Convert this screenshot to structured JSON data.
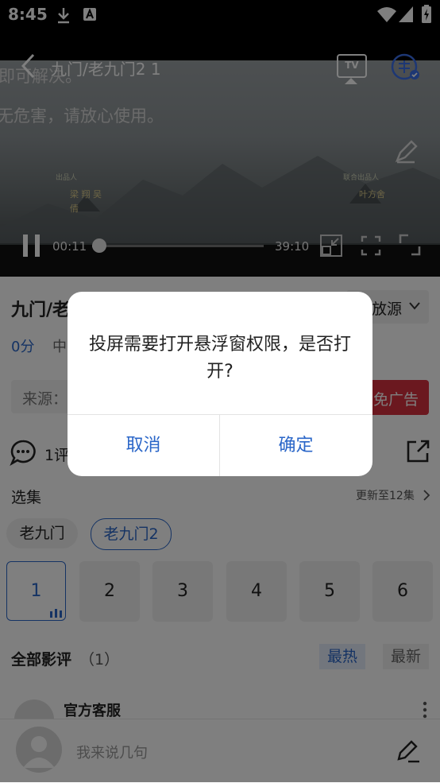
{
  "status_bar": {
    "time": "8:45"
  },
  "player": {
    "title": "九门/老九门2 1",
    "subtitle_top": "即可解决。",
    "subtitle_line": "无危害，请放心使用。",
    "credit_left_role": "出品人",
    "credit_left_names": "梁 翔 吴 倩",
    "credit_right_role": "联合出品人",
    "credit_right_names": "叶方舍",
    "current_time": "00:11",
    "total_time": "39:10",
    "progress": 0.02,
    "tv_label": "TV"
  },
  "info": {
    "title": "九门/老",
    "score": "0分",
    "meta": "中",
    "source_label": "来源：",
    "switch_source": "放源",
    "ad_button": "免广告",
    "comments_count": "1评"
  },
  "episodes": {
    "heading": "选集",
    "update_text": "更新至12集",
    "seasons": [
      {
        "label": "老九门",
        "selected": false
      },
      {
        "label": "老九门2",
        "selected": true
      }
    ],
    "items": [
      "1",
      "2",
      "3",
      "4",
      "5",
      "6"
    ],
    "selected_index": 0
  },
  "reviews": {
    "heading": "全部影评",
    "count": "（1）",
    "sort_hot": "最热",
    "sort_new": "最新",
    "first_author": "官方客服"
  },
  "comment_bar": {
    "placeholder": "我来说几句"
  },
  "dialog": {
    "message": "投屏需要打开悬浮窗权限，是否打开?",
    "cancel": "取消",
    "confirm": "确定"
  },
  "colors": {
    "accent": "#2a66c8",
    "ad_red": "#d6303f",
    "overlay": "rgba(0,0,0,0.5)"
  }
}
